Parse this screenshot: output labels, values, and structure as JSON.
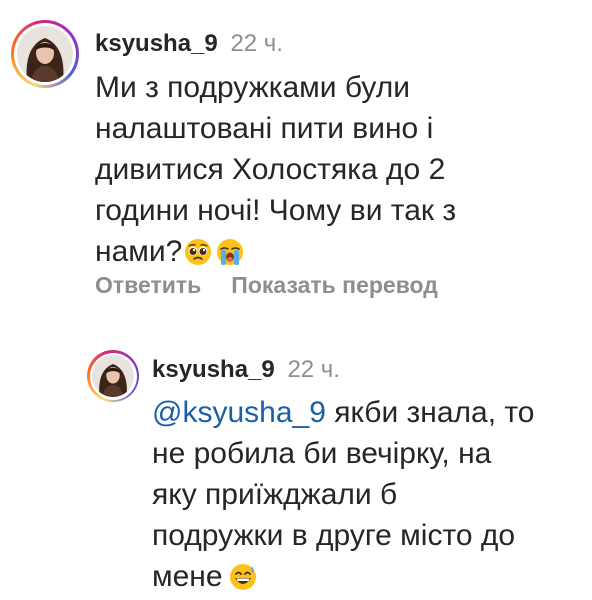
{
  "comments": [
    {
      "username": "ksyusha_9",
      "time": "22 ч.",
      "avatar_icon": "user-avatar-photo",
      "text_lines": [
        "Ми з подружками були",
        "налаштовані пити вино і",
        "дивитися Холостяка до 2",
        "години ночі! Чому ви так з",
        "нами?"
      ],
      "emojis": [
        "pleading-face-emoji",
        "loudly-crying-face-emoji"
      ],
      "actions": {
        "reply": "Ответить",
        "translate": "Показать перевод"
      }
    },
    {
      "username": "ksyusha_9",
      "time": "22 ч.",
      "avatar_icon": "user-avatar-photo",
      "mention": "@ksyusha_9",
      "text_lines": [
        " якби знала, то",
        "не робила би вечірку, на",
        "яку приїжджали б",
        "подружки в друге місто до",
        "мене"
      ],
      "emojis": [
        "grinning-face-with-sweat-emoji"
      ]
    }
  ]
}
